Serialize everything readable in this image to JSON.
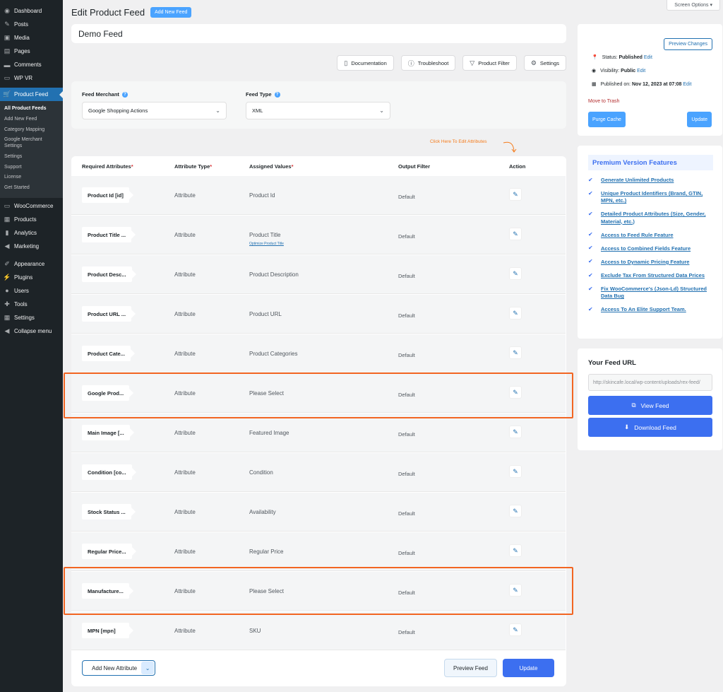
{
  "sidebar": {
    "items_top": [
      {
        "label": "Dashboard",
        "icon": "dashboard-icon",
        "glyph": "◉"
      },
      {
        "label": "Posts",
        "icon": "pin-icon",
        "glyph": "✎"
      },
      {
        "label": "Media",
        "icon": "media-icon",
        "glyph": "▣"
      },
      {
        "label": "Pages",
        "icon": "pages-icon",
        "glyph": "▤"
      },
      {
        "label": "Comments",
        "icon": "comments-icon",
        "glyph": "▬"
      },
      {
        "label": "WP VR",
        "icon": "vr-icon",
        "glyph": "▭"
      }
    ],
    "active": {
      "label": "Product Feed",
      "icon": "cart-icon",
      "glyph": "🛒"
    },
    "submenu": [
      "All Product Feeds",
      "Add New Feed",
      "Category Mapping",
      "Google Merchant Settings",
      "Settings",
      "Support",
      "License",
      "Get Started"
    ],
    "items_mid": [
      {
        "label": "WooCommerce",
        "icon": "woo-icon",
        "glyph": "▭"
      },
      {
        "label": "Products",
        "icon": "products-icon",
        "glyph": "▦"
      },
      {
        "label": "Analytics",
        "icon": "analytics-icon",
        "glyph": "▮"
      },
      {
        "label": "Marketing",
        "icon": "marketing-icon",
        "glyph": "◀"
      }
    ],
    "items_bottom": [
      {
        "label": "Appearance",
        "icon": "brush-icon",
        "glyph": "✐"
      },
      {
        "label": "Plugins",
        "icon": "plugin-icon",
        "glyph": "⚡"
      },
      {
        "label": "Users",
        "icon": "user-icon",
        "glyph": "●"
      },
      {
        "label": "Tools",
        "icon": "wrench-icon",
        "glyph": "✚"
      },
      {
        "label": "Settings",
        "icon": "settings-icon",
        "glyph": "▦"
      },
      {
        "label": "Collapse menu",
        "icon": "collapse-icon",
        "glyph": "◀"
      }
    ]
  },
  "header": {
    "title": "Edit Product Feed",
    "add_new": "Add New Feed",
    "screen_options": "Screen Options"
  },
  "feed_name": "Demo Feed",
  "toolbar": {
    "documentation": "Documentation",
    "troubleshoot": "Troubleshoot",
    "product_filter": "Product Filter",
    "settings": "Settings"
  },
  "merchant": {
    "merchant_label": "Feed Merchant",
    "merchant_value": "Google Shopping Actions",
    "type_label": "Feed Type",
    "type_value": "XML"
  },
  "hint": "Click Here To Edit Attributes",
  "table": {
    "headers": {
      "required": "Required Attributes",
      "type": "Attribute Type",
      "values": "Assigned Values",
      "filter": "Output Filter",
      "action": "Action"
    },
    "rows": [
      {
        "name": "Product Id [id]",
        "type": "Attribute",
        "value": "Product Id",
        "filter": "Default"
      },
      {
        "name": "Product Title ...",
        "type": "Attribute",
        "value": "Product Title",
        "sub": "Optimize Product Title",
        "filter": "Default"
      },
      {
        "name": "Product Desc...",
        "type": "Attribute",
        "value": "Product Description",
        "filter": "Default"
      },
      {
        "name": "Product URL ...",
        "type": "Attribute",
        "value": "Product URL",
        "filter": "Default"
      },
      {
        "name": "Product Cate...",
        "type": "Attribute",
        "value": "Product Categories",
        "filter": "Default"
      },
      {
        "name": "Google Prod...",
        "type": "Attribute",
        "value": "Please Select",
        "filter": "Default"
      },
      {
        "name": "Main Image [...",
        "type": "Attribute",
        "value": "Featured Image",
        "filter": "Default"
      },
      {
        "name": "Condition [co...",
        "type": "Attribute",
        "value": "Condition",
        "filter": "Default"
      },
      {
        "name": "Stock Status ...",
        "type": "Attribute",
        "value": "Availability",
        "filter": "Default"
      },
      {
        "name": "Regular Price...",
        "type": "Attribute",
        "value": "Regular Price",
        "filter": "Default"
      },
      {
        "name": "Manufacture...",
        "type": "Attribute",
        "value": "Please Select",
        "filter": "Default"
      },
      {
        "name": "MPN [mpn]",
        "type": "Attribute",
        "value": "SKU",
        "filter": "Default"
      }
    ],
    "add_attribute": "Add New Attribute",
    "preview_feed": "Preview Feed",
    "update": "Update"
  },
  "publish": {
    "preview_changes": "Preview Changes",
    "status_label": "Status:",
    "status_value": "Published",
    "visibility_label": "Visibility:",
    "visibility_value": "Public",
    "published_label": "Published on:",
    "published_value": "Nov 12, 2023 at 07:08",
    "edit": "Edit",
    "move_to_trash": "Move to Trash",
    "purge_cache": "Purge Cache",
    "update": "Update"
  },
  "premium": {
    "title": "Premium Version Features",
    "items": [
      "Generate Unlimited Products",
      "Unique Product Identifiers (Brand, GTIN, MPN, etc.)",
      "Detailed Product Attributes (Size, Gender, Material, etc.)",
      "Access to Feed Rule Feature",
      "Access to Combined Fields Feature",
      "Access to Dynamic Pricing Feature",
      "Exclude Tax From Structured Data Prices",
      "Fix WooCommerce's (Json-Ld) Structured Data Bug",
      "Access To An Elite Support Team."
    ]
  },
  "feed_url": {
    "title": "Your Feed URL",
    "value": "http://skincafe.local/wp-content/uploads/rex-feed/",
    "view": "View Feed",
    "download": "Download Feed"
  },
  "colors": {
    "accent": "#3c6ff0",
    "highlight": "#f26522",
    "sidebar": "#1d2327"
  }
}
